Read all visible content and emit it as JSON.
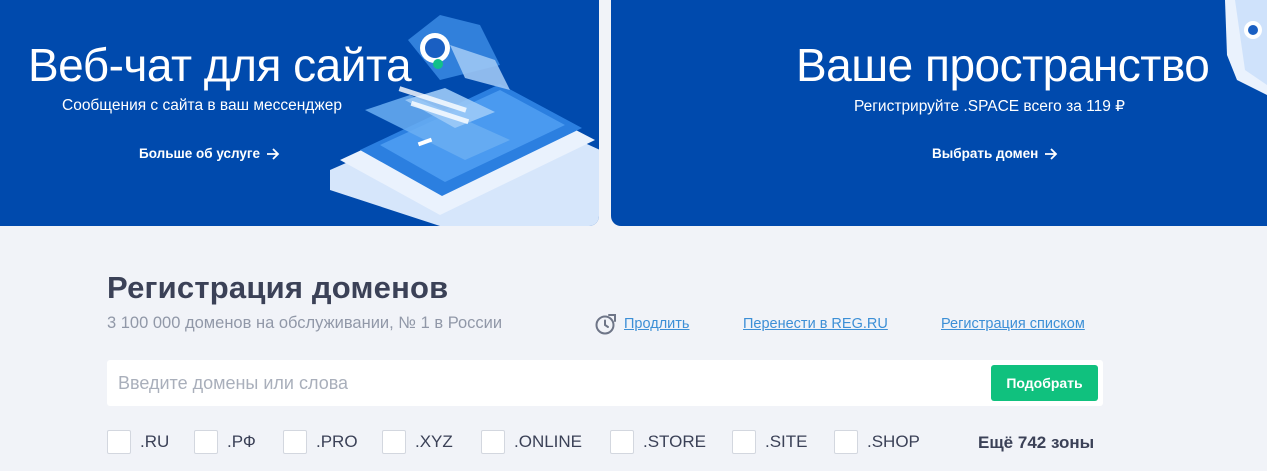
{
  "banners": {
    "left": {
      "title": "Веб-чат для сайта",
      "subtitle": "Сообщения с сайта в ваш мессенджер",
      "link": "Больше об услуге"
    },
    "right": {
      "title": "Ваше пространство",
      "subtitle": "Регистрируйте .SPACE всего за 119 ₽",
      "link": "Выбрать домен"
    }
  },
  "domains": {
    "title": "Регистрация доменов",
    "subtitle": "3 100 000 доменов на обслуживании, № 1 в России",
    "links": {
      "renew": "Продлить",
      "transfer": "Перенести в REG.RU",
      "bulk": "Регистрация списком"
    },
    "search": {
      "placeholder": "Введите домены или слова",
      "value": "",
      "button": "Подобрать"
    },
    "zones": [
      ".RU",
      ".РФ",
      ".PRO",
      ".XYZ",
      ".ONLINE",
      ".STORE",
      ".SITE",
      ".SHOP"
    ],
    "more": "Ещё 742 зоны"
  },
  "colors": {
    "banner_bg": "#004aad",
    "accent_green": "#10c17e",
    "link_blue": "#3c8fd6",
    "page_bg": "#f1f3f8",
    "heading": "#3b4157"
  },
  "icons": [
    "arrow-right-icon",
    "clock-icon",
    "chat-phone-illustration",
    "corner-illustration"
  ]
}
